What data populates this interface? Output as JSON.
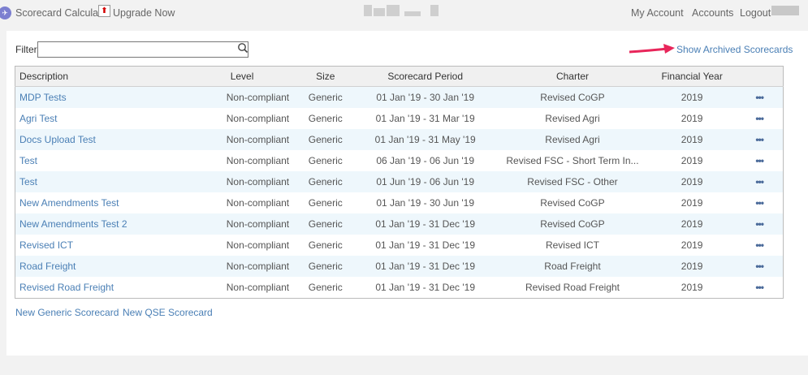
{
  "header": {
    "app_title": "Scorecard Calculator",
    "upgrade_label": "Upgrade Now",
    "nav": [
      "My Account",
      "Accounts",
      "Logout"
    ]
  },
  "toolbar": {
    "filter_label": "Filter",
    "filter_value": "",
    "archived_link": "Show Archived Scorecards"
  },
  "table": {
    "columns": [
      "Description",
      "Level",
      "Size",
      "Scorecard Period",
      "Charter",
      "Financial Year"
    ],
    "rows": [
      [
        "MDP Tests",
        "Non-compliant",
        "Generic",
        "01 Jan '19 - 30 Jan '19",
        "Revised CoGP",
        "2019"
      ],
      [
        "Agri Test",
        "Non-compliant",
        "Generic",
        "01 Jan '19 - 31 Mar '19",
        "Revised Agri",
        "2019"
      ],
      [
        "Docs Upload Test",
        "Non-compliant",
        "Generic",
        "01 Jan '19 - 31 May '19",
        "Revised Agri",
        "2019"
      ],
      [
        "Test",
        "Non-compliant",
        "Generic",
        "06 Jan '19 - 06 Jun '19",
        "Revised FSC - Short Term In...",
        "2019"
      ],
      [
        "Test",
        "Non-compliant",
        "Generic",
        "01 Jun '19 - 06 Jun '19",
        "Revised FSC - Other",
        "2019"
      ],
      [
        "New Amendments Test",
        "Non-compliant",
        "Generic",
        "01 Jan '19 - 30 Jun '19",
        "Revised CoGP",
        "2019"
      ],
      [
        "New Amendments Test 2",
        "Non-compliant",
        "Generic",
        "01 Jan '19 - 31 Dec '19",
        "Revised CoGP",
        "2019"
      ],
      [
        "Revised ICT",
        "Non-compliant",
        "Generic",
        "01 Jan '19 - 31 Dec '19",
        "Revised ICT",
        "2019"
      ],
      [
        "Road Freight",
        "Non-compliant",
        "Generic",
        "01 Jan '19 - 31 Dec '19",
        "Road Freight",
        "2019"
      ],
      [
        "Revised Road Freight",
        "Non-compliant",
        "Generic",
        "01 Jan '19 - 31 Dec '19",
        "Revised Road Freight",
        "2019"
      ]
    ],
    "row_action": "•••"
  },
  "footer": {
    "new_generic": "New Generic Scorecard",
    "new_qse": "New QSE Scorecard"
  },
  "colors": {
    "link": "#4a7fb5",
    "alt_row": "#eef7fc",
    "arrow": "#e8265a"
  }
}
